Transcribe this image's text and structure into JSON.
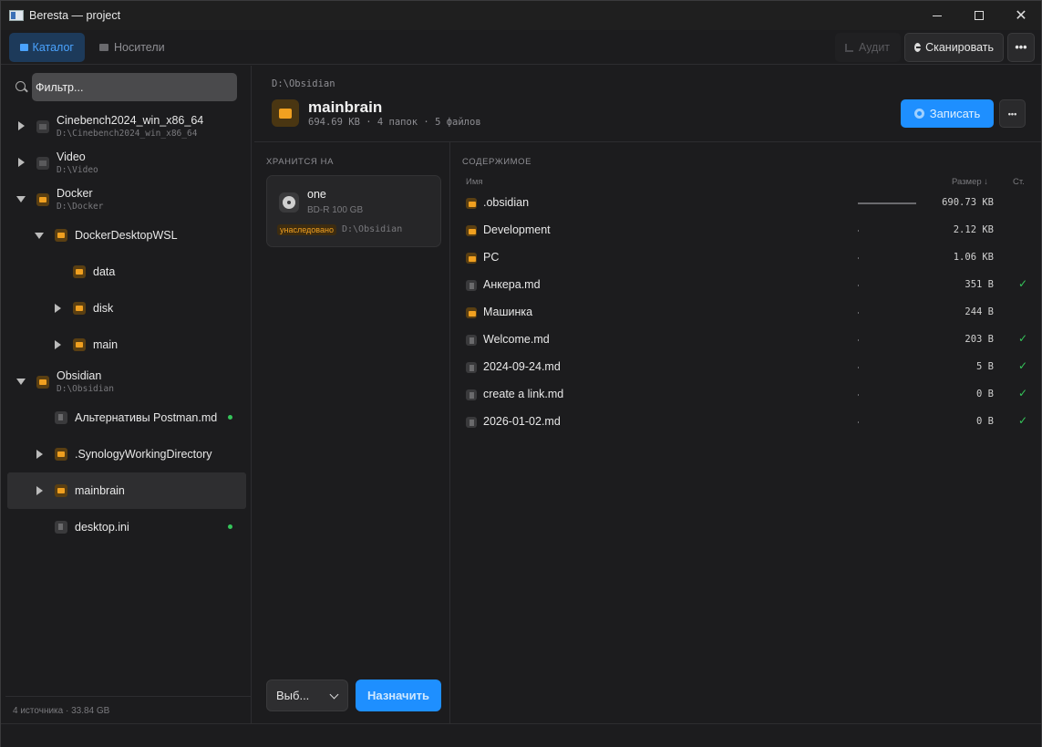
{
  "window": {
    "title": "Beresta — project"
  },
  "toolbar": {
    "tab_catalog": "Каталог",
    "tab_media": "Носители",
    "audit_label": "Аудит",
    "scan_label": "Сканировать"
  },
  "sidebar": {
    "filter_placeholder": "Фильтр...",
    "tree": [
      {
        "name": "Cinebench2024_win_x86_64",
        "path": "D:\\Cinebench2024_win_x86_64"
      },
      {
        "name": "Video",
        "path": "D:\\Video"
      },
      {
        "name": "Docker",
        "path": "D:\\Docker"
      },
      {
        "name": "DockerDesktopWSL"
      },
      {
        "name": "data"
      },
      {
        "name": "disk"
      },
      {
        "name": "main"
      },
      {
        "name": "Obsidian",
        "path": "D:\\Obsidian"
      },
      {
        "name": "Альтернативы Postman.md"
      },
      {
        "name": ".SynologyWorkingDirectory"
      },
      {
        "name": "mainbrain"
      },
      {
        "name": "desktop.ini"
      }
    ],
    "footer": "4 источника · 33.84 GB"
  },
  "header": {
    "breadcrumb": "D:\\Obsidian",
    "title": "mainbrain",
    "meta": "694.69 KB · 4 папок · 5 файлов",
    "write_label": "Записать"
  },
  "storage": {
    "section_label": "ХРАНИТСЯ НА",
    "disc_name": "one",
    "disc_type": "BD-R 100 GB",
    "badge": "унаследовано",
    "disc_path": "D:\\Obsidian",
    "select_value": "Выб...",
    "assign_label": "Назначить"
  },
  "contents": {
    "section_label": "СОДЕРЖИМОЕ",
    "col_name": "Имя",
    "col_size": "Размер ↓",
    "col_status": "Ст.",
    "rows": [
      {
        "name": ".obsidian",
        "size": "690.73 KB",
        "kind": "folder",
        "share": 0.994,
        "check": ""
      },
      {
        "name": "Development",
        "size": "2.12 KB",
        "kind": "folder",
        "share": 0.003,
        "check": ""
      },
      {
        "name": "PC",
        "size": "1.06 KB",
        "kind": "folder",
        "share": 0.0015,
        "check": ""
      },
      {
        "name": "Анкера.md",
        "size": "351 B",
        "kind": "file",
        "share": 0.0005,
        "check": "✓"
      },
      {
        "name": "Машинка",
        "size": "244 B",
        "kind": "folder",
        "share": 0.0003,
        "check": ""
      },
      {
        "name": "Welcome.md",
        "size": "203 B",
        "kind": "file",
        "share": 0.0003,
        "check": "✓"
      },
      {
        "name": "2024-09-24.md",
        "size": "5 B",
        "kind": "file",
        "share": 0,
        "check": "✓"
      },
      {
        "name": "create a link.md",
        "size": "0 B",
        "kind": "file",
        "share": 0,
        "check": "✓"
      },
      {
        "name": "2026-01-02.md",
        "size": "0 B",
        "kind": "file",
        "share": 0,
        "check": "✓"
      }
    ]
  }
}
